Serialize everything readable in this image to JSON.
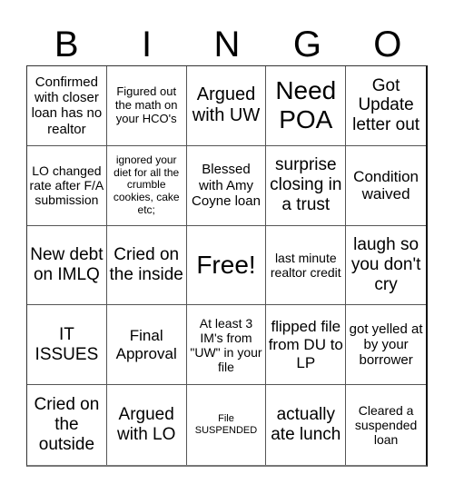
{
  "header": {
    "letters": [
      "B",
      "I",
      "N",
      "G",
      "O"
    ]
  },
  "cells": [
    "Confirmed with closer loan has no realtor",
    "Figured out the math on your HCO's",
    "Argued with UW",
    "Need POA",
    "Got Update letter out",
    "LO changed rate after F/A submission",
    "ignored your diet for all the crumble cookies, cake etc;",
    "Blessed with Amy Coyne loan",
    "surprise closing in a trust",
    "Condition waived",
    "New debt on IMLQ",
    "Cried on the inside",
    "Free!",
    "last minute realtor credit",
    "laugh so you don't cry",
    "IT ISSUES",
    "Final Approval",
    "At least 3 IM's from \"UW\" in your file",
    "flipped file from DU to LP",
    "got yelled at by your borrower",
    "Cried on the outside",
    "Argued with LO",
    "File SUSPENDED",
    "actually ate lunch",
    "Cleared a suspended loan"
  ]
}
